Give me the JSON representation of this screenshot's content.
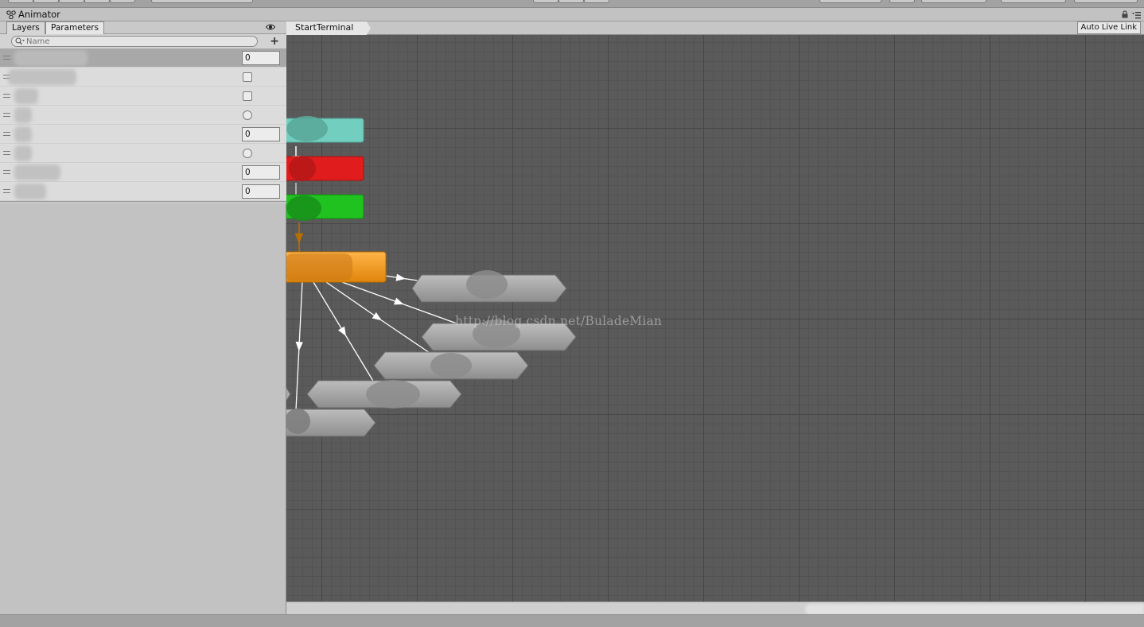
{
  "window": {
    "title": "Animator"
  },
  "tabs": [
    {
      "label": "Layers",
      "active": false
    },
    {
      "label": "Parameters",
      "active": true
    }
  ],
  "search": {
    "placeholder": "Name",
    "value": ""
  },
  "parameters": [
    {
      "kind": "float",
      "value": "0",
      "selected": true
    },
    {
      "kind": "bool"
    },
    {
      "kind": "bool"
    },
    {
      "kind": "trigger"
    },
    {
      "kind": "float",
      "value": "0"
    },
    {
      "kind": "trigger"
    },
    {
      "kind": "int",
      "value": "0"
    },
    {
      "kind": "int",
      "value": "0"
    }
  ],
  "graph": {
    "breadcrumb": "StartTerminal",
    "auto_live_link": "Auto Live Link",
    "watermark": "http://blog.csdn.net/BuladeMian",
    "states": [
      {
        "kind": "entry",
        "color": "#72cfbf"
      },
      {
        "kind": "exit",
        "color": "#e01c1c"
      },
      {
        "kind": "any-state",
        "color": "#1fc21f"
      },
      {
        "kind": "default-state",
        "color": "#f39a1a"
      },
      {
        "kind": "state",
        "color": "#a8a8a8"
      },
      {
        "kind": "state",
        "color": "#a8a8a8"
      },
      {
        "kind": "state",
        "color": "#a8a8a8"
      },
      {
        "kind": "state",
        "color": "#a8a8a8"
      },
      {
        "kind": "state",
        "color": "#a8a8a8"
      }
    ]
  },
  "icons": {
    "window": "animator-icon",
    "lock": "lock-icon",
    "menu": "menu-icon",
    "eye": "eye-icon",
    "search": "search-icon",
    "add": "plus-icon"
  }
}
